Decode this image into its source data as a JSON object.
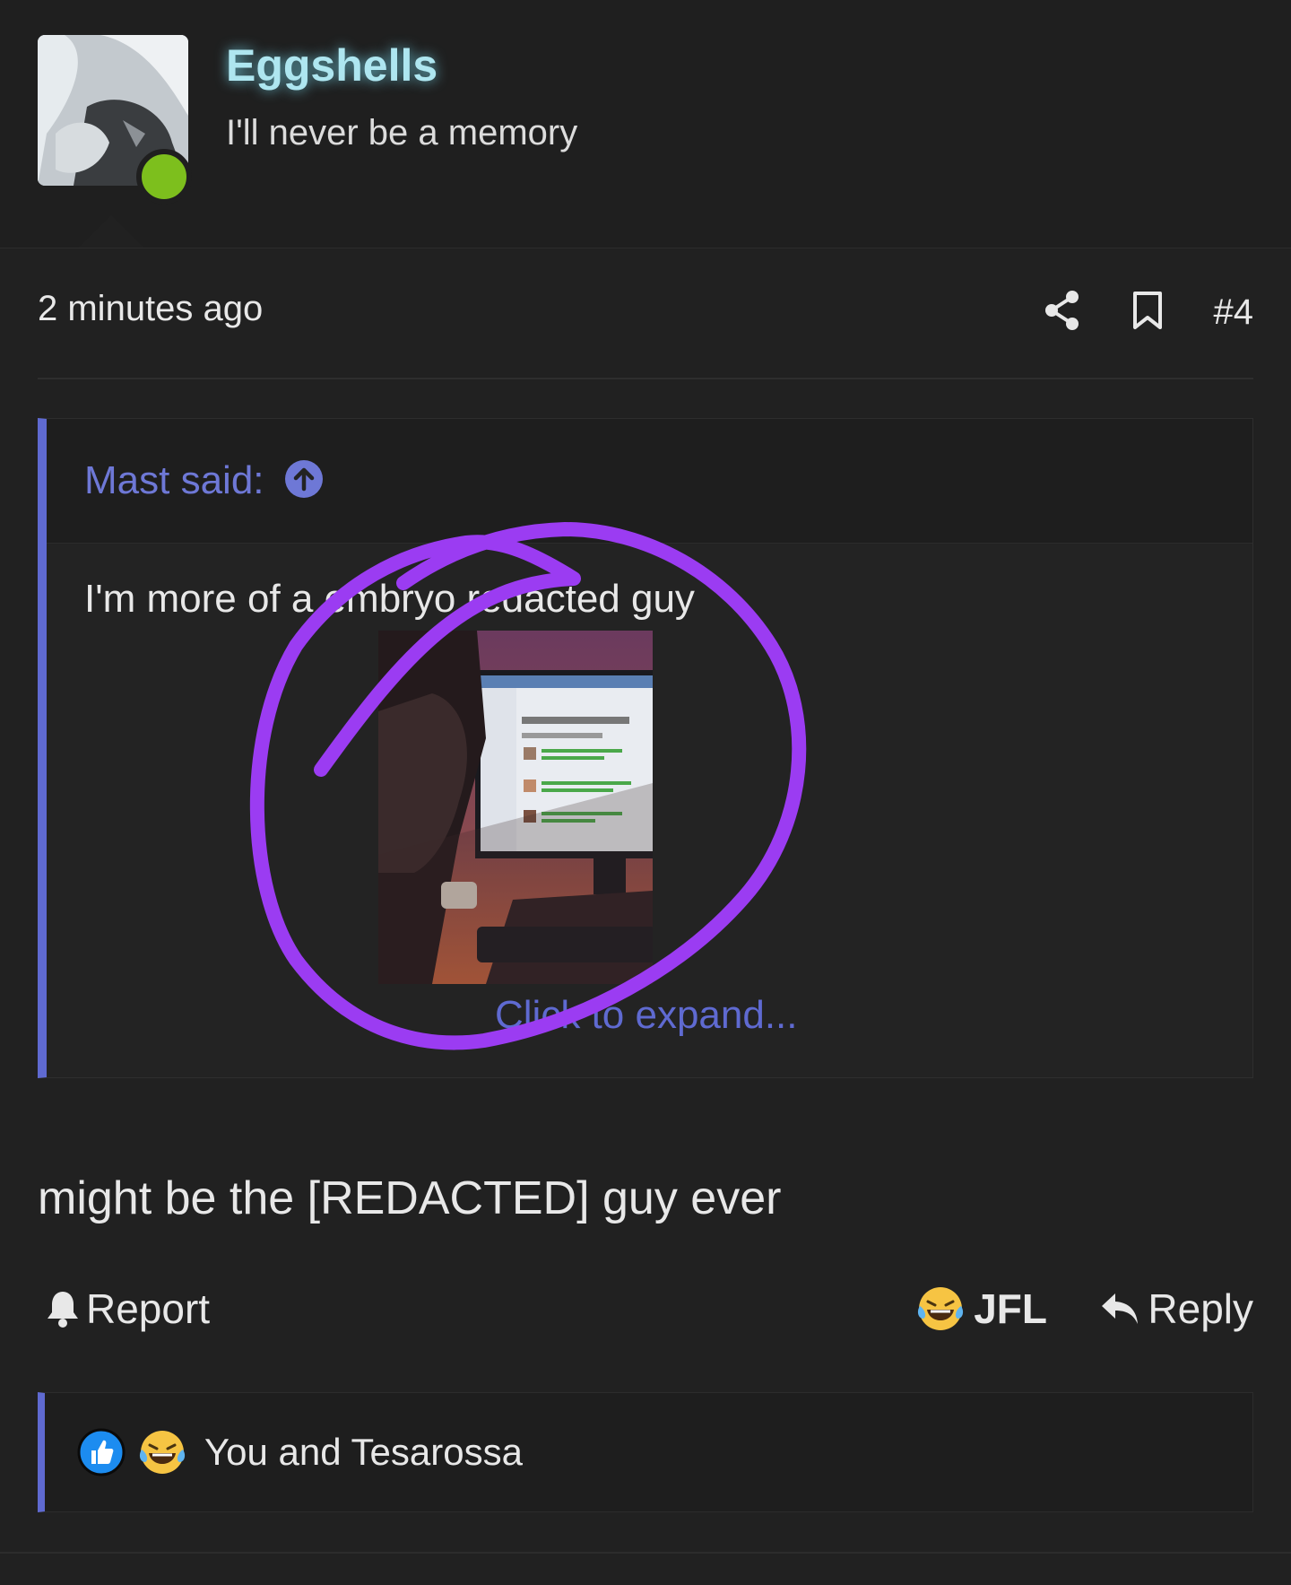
{
  "user": {
    "name": "Eggshells",
    "title": "I'll never be a memory"
  },
  "post": {
    "time": "2 minutes ago",
    "number": "#4",
    "body": "might be the [REDACTED] guy ever"
  },
  "quote": {
    "author": "Mast said:",
    "text": "I'm more of a embryo redacted guy",
    "expand": "Click to expand..."
  },
  "actions": {
    "report": "Report",
    "jfl": "JFL",
    "reply": "Reply"
  },
  "reactions": {
    "label": "You and Tesarossa"
  },
  "colors": {
    "background": "#212121",
    "accent": "#5f6ad1",
    "username": "#aee6f0",
    "online": "#7dbf1d",
    "annotation": "#9b3cf2"
  }
}
